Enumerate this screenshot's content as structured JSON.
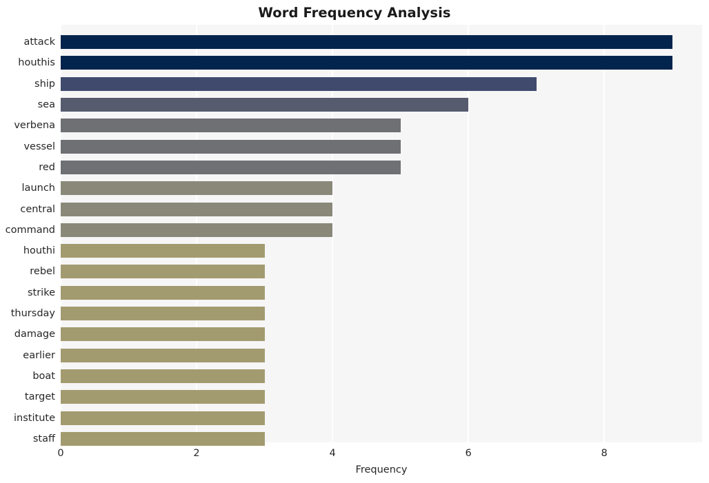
{
  "chart_data": {
    "type": "bar",
    "orientation": "horizontal",
    "title": "Word Frequency Analysis",
    "xlabel": "Frequency",
    "ylabel": "",
    "categories": [
      "attack",
      "houthis",
      "ship",
      "sea",
      "verbena",
      "vessel",
      "red",
      "launch",
      "central",
      "command",
      "houthi",
      "rebel",
      "strike",
      "thursday",
      "damage",
      "earlier",
      "boat",
      "target",
      "institute",
      "staff"
    ],
    "values": [
      9,
      9,
      7,
      6,
      5,
      5,
      5,
      4,
      4,
      4,
      3,
      3,
      3,
      3,
      3,
      3,
      3,
      3,
      3,
      3
    ],
    "bar_colors": [
      "#03244d",
      "#03244d",
      "#3f4a6d",
      "#565b6e",
      "#6e7073",
      "#6e7073",
      "#6e7073",
      "#8a8879",
      "#8a8879",
      "#8a8879",
      "#a39b70",
      "#a39b70",
      "#a39b70",
      "#a39b70",
      "#a39b70",
      "#a39b70",
      "#a39b70",
      "#a39b70",
      "#a39b70",
      "#a39b70"
    ],
    "xlim": [
      0,
      9.44
    ],
    "xticks": [
      0,
      2,
      4,
      6,
      8
    ],
    "xtick_labels": [
      "0",
      "2",
      "4",
      "6",
      "8"
    ],
    "grid": "vertical-white",
    "legend": "none",
    "plot_background": "#f6f6f7",
    "figure_background": "#ffffff"
  }
}
